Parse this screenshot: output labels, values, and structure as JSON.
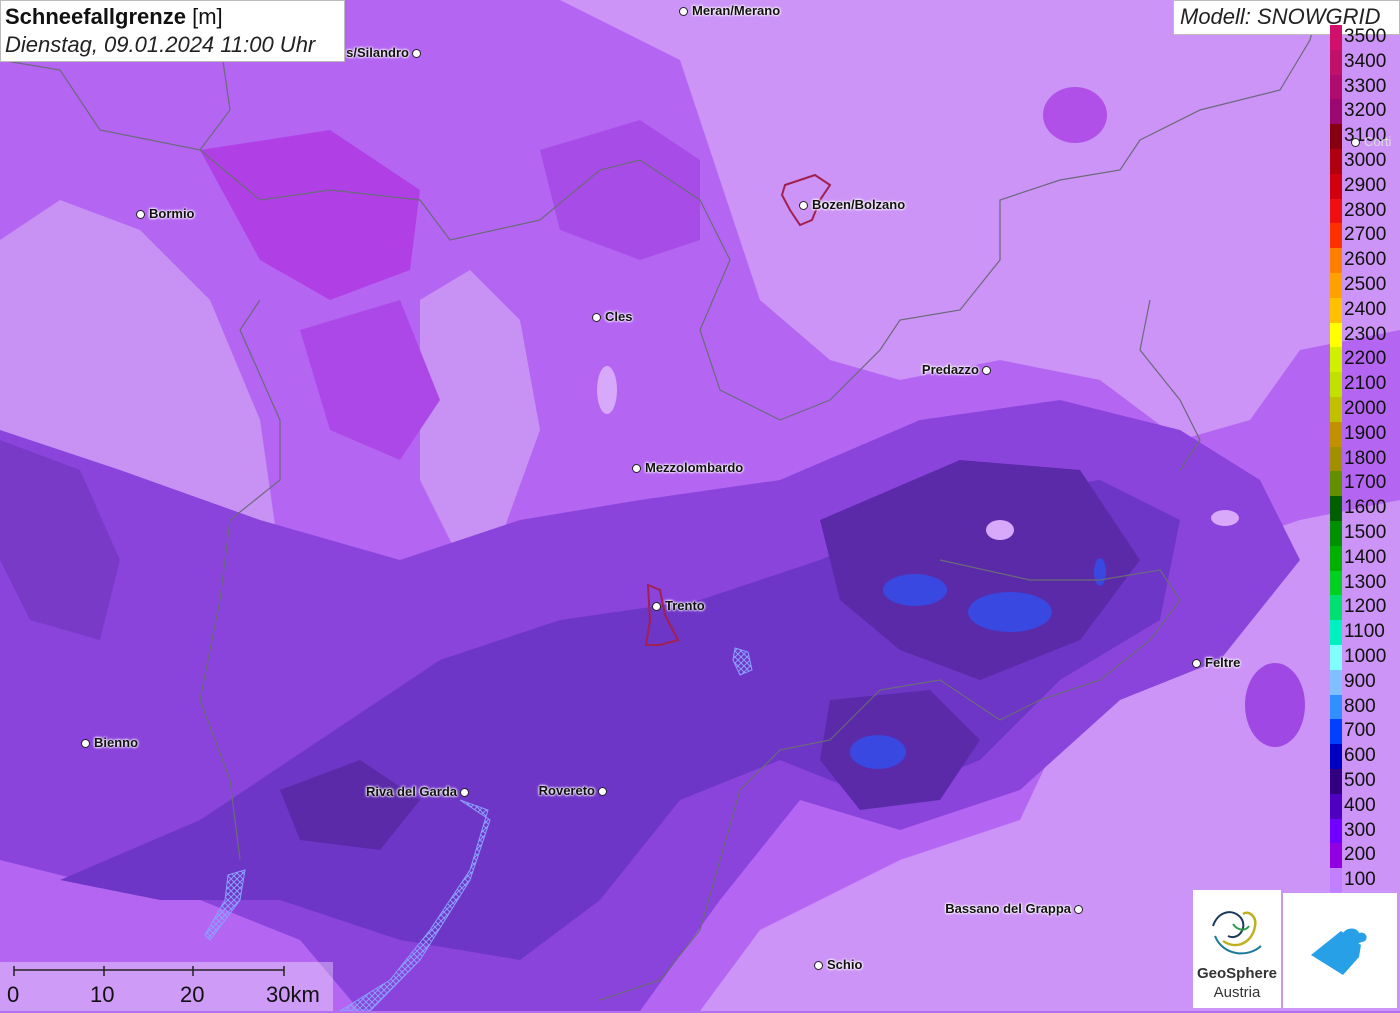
{
  "header": {
    "title_bold": "Schneefallgrenze",
    "title_unit": "[m]",
    "datetime": "Dienstag, 09.01.2024 11:00 Uhr"
  },
  "model": {
    "label": "Modell: SNOWGRID"
  },
  "legend": {
    "levels": [
      {
        "value": "3500",
        "color": "#d0106a"
      },
      {
        "value": "3400",
        "color": "#c0106a"
      },
      {
        "value": "3300",
        "color": "#b00c70"
      },
      {
        "value": "3200",
        "color": "#9c0870"
      },
      {
        "value": "3100",
        "color": "#880010"
      },
      {
        "value": "3000",
        "color": "#b00010"
      },
      {
        "value": "2900",
        "color": "#d00010"
      },
      {
        "value": "2800",
        "color": "#ee1010"
      },
      {
        "value": "2700",
        "color": "#ff3000"
      },
      {
        "value": "2600",
        "color": "#ff8000"
      },
      {
        "value": "2500",
        "color": "#ffa000"
      },
      {
        "value": "2400",
        "color": "#ffc000"
      },
      {
        "value": "2300",
        "color": "#ffff00"
      },
      {
        "value": "2200",
        "color": "#d0f000"
      },
      {
        "value": "2100",
        "color": "#c0e000"
      },
      {
        "value": "2000",
        "color": "#c0c000"
      },
      {
        "value": "1900",
        "color": "#c09000"
      },
      {
        "value": "1800",
        "color": "#a09000"
      },
      {
        "value": "1700",
        "color": "#609000"
      },
      {
        "value": "1600",
        "color": "#006000"
      },
      {
        "value": "1500",
        "color": "#009000"
      },
      {
        "value": "1400",
        "color": "#00b000"
      },
      {
        "value": "1300",
        "color": "#00d020"
      },
      {
        "value": "1200",
        "color": "#00e070"
      },
      {
        "value": "1100",
        "color": "#00f0c0"
      },
      {
        "value": "1000",
        "color": "#80ffff"
      },
      {
        "value": "900",
        "color": "#80c0ff"
      },
      {
        "value": "800",
        "color": "#3090ff"
      },
      {
        "value": "700",
        "color": "#0040ff"
      },
      {
        "value": "600",
        "color": "#0000c0"
      },
      {
        "value": "500",
        "color": "#300080"
      },
      {
        "value": "400",
        "color": "#5000c0"
      },
      {
        "value": "300",
        "color": "#7000ff"
      },
      {
        "value": "200",
        "color": "#9000e0"
      },
      {
        "value": "100",
        "color": "#c080ff"
      }
    ]
  },
  "cities": [
    {
      "name": "Meran/Merano",
      "side": "right"
    },
    {
      "name": "s/Silandro",
      "side": "left"
    },
    {
      "name": "Bormio",
      "side": "right"
    },
    {
      "name": "Bozen/Bolzano",
      "side": "right"
    },
    {
      "name": "Cles",
      "side": "right"
    },
    {
      "name": "Predazzo",
      "side": "left"
    },
    {
      "name": "Mezzolombardo",
      "side": "right"
    },
    {
      "name": "Trento",
      "side": "right"
    },
    {
      "name": "Feltre",
      "side": "right"
    },
    {
      "name": "Bienno",
      "side": "right"
    },
    {
      "name": "Riva del Garda",
      "side": "left"
    },
    {
      "name": "Rovereto",
      "side": "left"
    },
    {
      "name": "Bassano del Grappa",
      "side": "left"
    },
    {
      "name": "Schio",
      "side": "right"
    },
    {
      "name": "Corti",
      "side": "right"
    }
  ],
  "scalebar": {
    "labels": [
      "0",
      "10",
      "20",
      "30km"
    ]
  },
  "logos": {
    "geosphere_line1": "GeoSphere",
    "geosphere_line2": "Austria"
  },
  "colors": {
    "light_lilac": "#c88cf8",
    "violet": "#a658f0",
    "magenta": "#b040e0",
    "dark_violet": "#7a3ad6",
    "deep": "#5a2ab8",
    "blue": "#3040e0"
  }
}
